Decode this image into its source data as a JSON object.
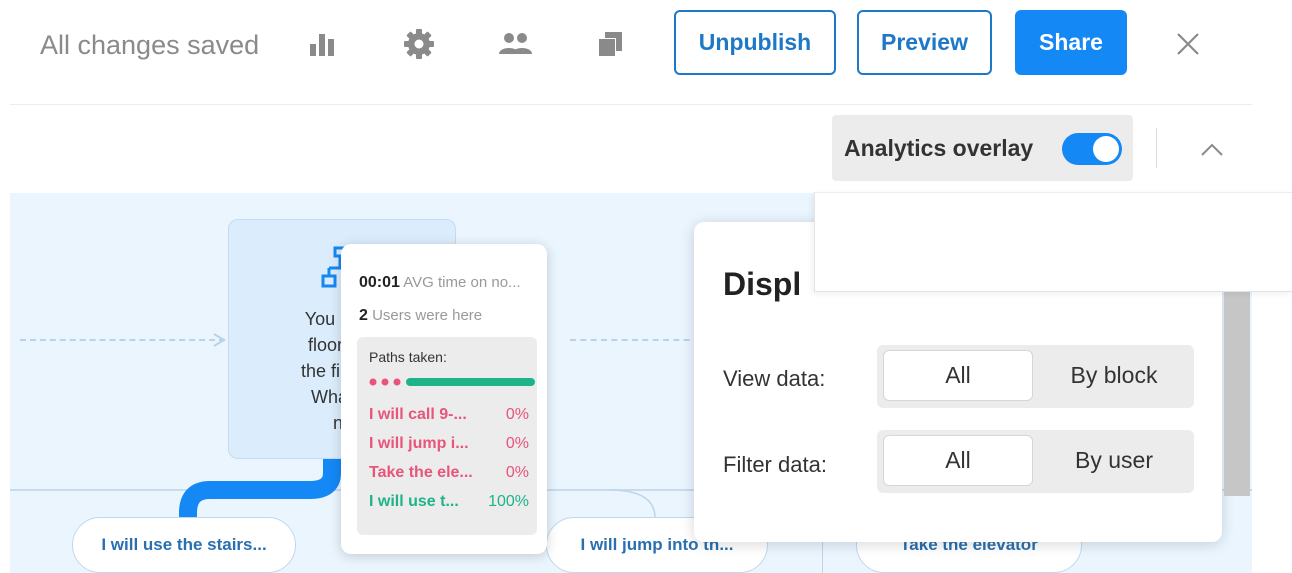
{
  "toolbar": {
    "save_status": "All changes saved",
    "icons": [
      "bar-chart-icon",
      "gear-icon",
      "users-icon",
      "copy-icon",
      "close-icon"
    ],
    "unpublish_label": "Unpublish",
    "preview_label": "Preview",
    "share_label": "Share"
  },
  "subbar": {
    "overlay_label": "Analytics overlay",
    "overlay_enabled": true
  },
  "canvas": {
    "node_text_lines": [
      "You are o",
      "floor and",
      "the fire ala",
      "What wi",
      "ne"
    ],
    "choices": [
      "I will use the stairs...",
      "I will jump into th...",
      "Take the elevator"
    ]
  },
  "stats": {
    "avg_time_value": "00:01",
    "avg_time_label": "AVG time on no...",
    "users_value": "2",
    "users_label": "Users were here",
    "paths_title": "Paths taken:",
    "paths": [
      {
        "label": "I will call 9-...",
        "pct": "0%",
        "color": "#e8547a"
      },
      {
        "label": "I will jump i...",
        "pct": "0%",
        "color": "#e8547a"
      },
      {
        "label": "Take the ele...",
        "pct": "0%",
        "color": "#e8547a"
      },
      {
        "label": "I will use t...",
        "pct": "100%",
        "color": "#1fb38a"
      }
    ]
  },
  "settings": {
    "title_visible": "Displ",
    "view_label": "View data:",
    "view_options": [
      "All",
      "By block"
    ],
    "view_selected": "All",
    "filter_label": "Filter data:",
    "filter_options": [
      "All",
      "By user"
    ],
    "filter_selected": "All"
  },
  "colors": {
    "accent": "#1488f5",
    "outline": "#1e78c8",
    "pink": "#e8547a",
    "green": "#1fb38a",
    "canvas": "#eaf5fe"
  }
}
